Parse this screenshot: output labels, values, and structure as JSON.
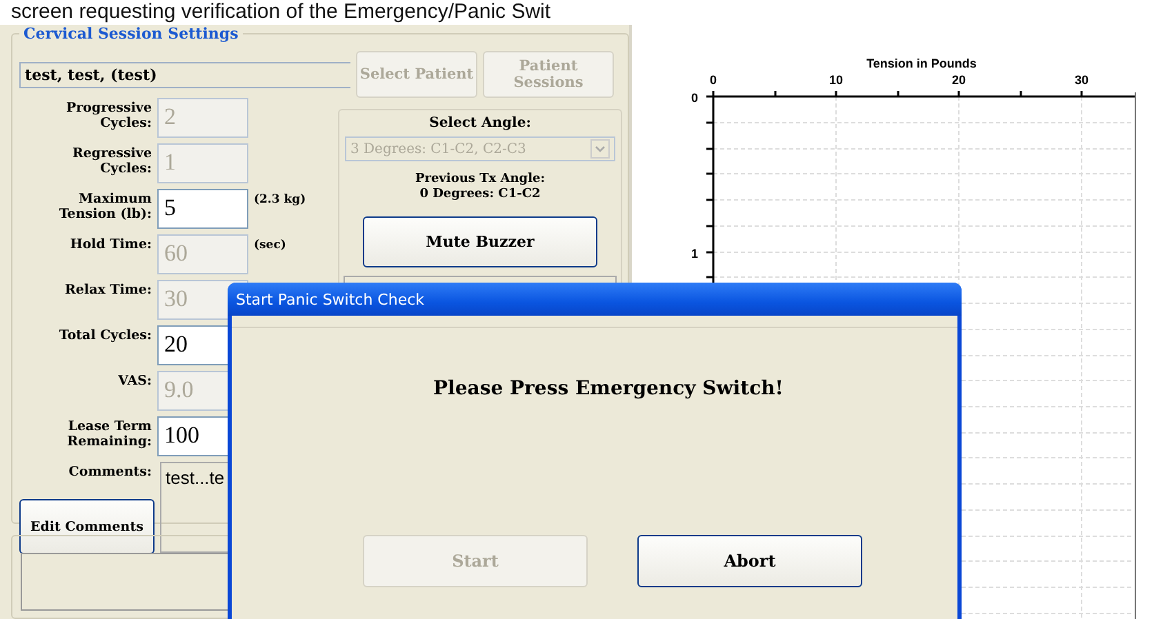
{
  "caption": "screen requesting verification of the Emergency/Panic Swit",
  "settings": {
    "title": "Cervical Session Settings",
    "patient": "test, test, (test)",
    "buttons": [
      {
        "label": "Select Patient",
        "disabled": true
      },
      {
        "label": "Patient Sessions",
        "disabled": true
      }
    ],
    "fields": [
      {
        "label": "Progressive Cycles:",
        "value": "2",
        "disabled": true
      },
      {
        "label": "Regressive Cycles:",
        "value": "1",
        "disabled": true
      },
      {
        "label": "Maximum Tension (lb):",
        "value": "5",
        "disabled": false,
        "unit": "(2.3 kg)"
      },
      {
        "label": "Hold Time:",
        "value": "60",
        "disabled": true,
        "unit": "(sec)"
      },
      {
        "label": "Relax Time:",
        "value": "30",
        "disabled": true
      },
      {
        "label": "Total Cycles:",
        "value": "20",
        "disabled": false
      },
      {
        "label": "VAS:",
        "value": "9.0",
        "disabled": true
      },
      {
        "label": "Lease Term Remaining:",
        "value": "100",
        "disabled": false
      }
    ],
    "comments_label": "Comments:",
    "comments": "test...te",
    "edit_comments": "Edit Comments",
    "angle_label": "Select Angle:",
    "angle": "3 Degrees: C1-C2, C2-C3",
    "angle_disabled": true,
    "previous_label": "Previous Tx Angle:",
    "previous_value": "0 Degrees: C1-C2",
    "mute": "Mute Buzzer"
  },
  "chart": {
    "title": "Tension in Pounds",
    "x_ticks": [
      "0",
      "10",
      "20",
      "30"
    ],
    "y_ticks": [
      "0",
      "1"
    ]
  },
  "dialog": {
    "title": "Start Panic Switch Check",
    "message": "Please Press Emergency Switch!",
    "buttons": [
      {
        "label": "Start",
        "disabled": true
      },
      {
        "label": "Abort",
        "disabled": false
      }
    ]
  }
}
